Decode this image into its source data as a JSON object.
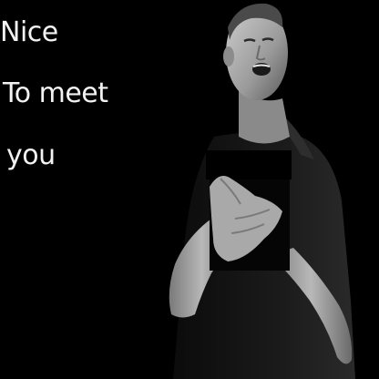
{
  "caption": {
    "lines": [
      "Nice",
      "To meet",
      "you"
    ]
  },
  "scene": {
    "background_color": "#000000",
    "tone": "grayscale"
  }
}
